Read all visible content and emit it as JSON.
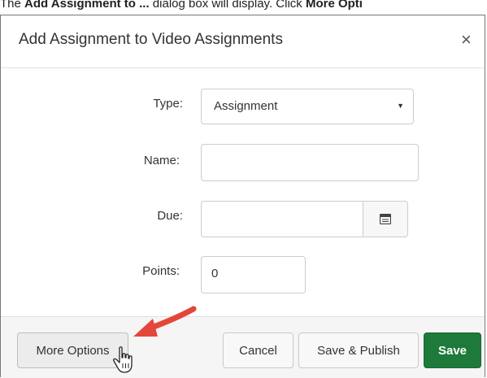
{
  "caption": {
    "prefix": "The ",
    "bold1": "Add Assignment to ...",
    "middle": " dialog box will display. Click ",
    "bold2": "More Opti"
  },
  "dialog": {
    "title": "Add Assignment to Video Assignments",
    "close_glyph": "×"
  },
  "form": {
    "type_label": "Type:",
    "type_value": "Assignment",
    "name_label": "Name:",
    "name_value": "",
    "due_label": "Due:",
    "due_value": "",
    "points_label": "Points:",
    "points_value": "0"
  },
  "footer": {
    "more_options": "More Options",
    "cancel": "Cancel",
    "save_publish": "Save & Publish",
    "save": "Save"
  },
  "icons": {
    "calendar": "calendar-icon",
    "arrow": "red-arrow-annotation",
    "cursor": "hand-pointer-cursor"
  },
  "colors": {
    "save_button": "#1d7a3a",
    "annotation_arrow": "#e2473a"
  }
}
